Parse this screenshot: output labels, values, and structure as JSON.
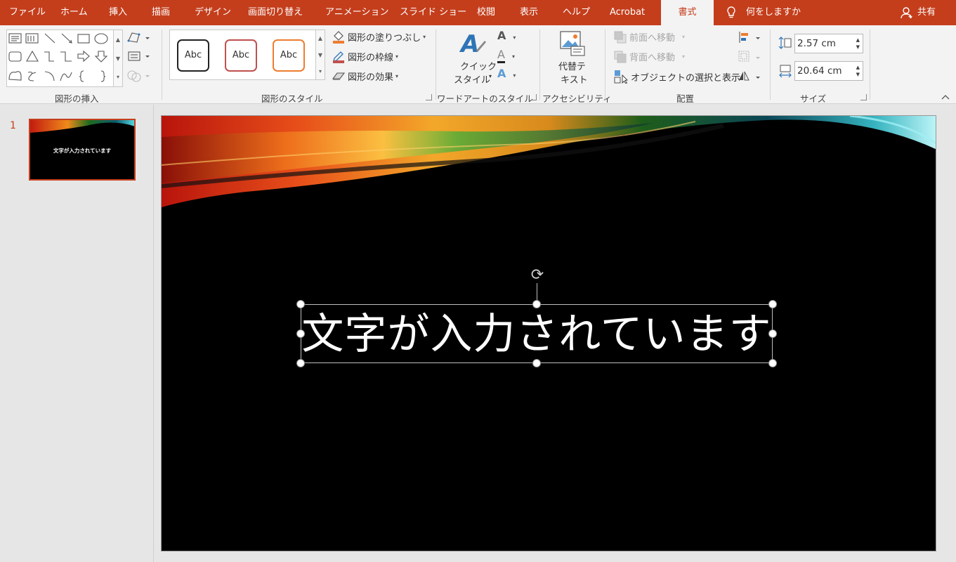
{
  "tabs": [
    {
      "label": "ファイル",
      "name": "tab-file"
    },
    {
      "label": "ホーム",
      "name": "tab-home"
    },
    {
      "label": "挿入",
      "name": "tab-insert"
    },
    {
      "label": "描画",
      "name": "tab-draw"
    },
    {
      "label": "デザイン",
      "name": "tab-design"
    },
    {
      "label": "画面切り替え",
      "name": "tab-transitions"
    },
    {
      "label": "アニメーション",
      "name": "tab-animations"
    },
    {
      "label": "スライド ショー",
      "name": "tab-slideshow"
    },
    {
      "label": "校閲",
      "name": "tab-review"
    },
    {
      "label": "表示",
      "name": "tab-view"
    },
    {
      "label": "ヘルプ",
      "name": "tab-help"
    },
    {
      "label": "Acrobat",
      "name": "tab-acrobat"
    },
    {
      "label": "書式",
      "name": "tab-format"
    }
  ],
  "tell_me": "何をしますか",
  "share": "共有",
  "groups": {
    "insert_shapes": "図形の挿入",
    "shape_styles": "図形のスタイル",
    "wordart_styles": "ワードアートのスタイル",
    "accessibility": "アクセシビリティ",
    "arrange": "配置",
    "size": "サイズ"
  },
  "style_gallery": [
    "Abc",
    "Abc",
    "Abc"
  ],
  "shape_fill": "図形の塗りつぶし",
  "shape_outline": "図形の枠線",
  "shape_effects": "図形の効果",
  "quick_styles": [
    "クイック",
    "スタイル"
  ],
  "alt_text": [
    "代替テ",
    "キスト"
  ],
  "bring_forward": "前面へ移動",
  "send_backward": "背面へ移動",
  "selection_pane": "オブジェクトの選択と表示",
  "height": "2.57 cm",
  "width": "20.64 cm",
  "slide_number": "1",
  "slide_title": "文字が入力されています",
  "colors": {
    "accent": "#c43e1c",
    "ribbon_bg": "#f3f3f3",
    "slide_bg": "#000000"
  }
}
